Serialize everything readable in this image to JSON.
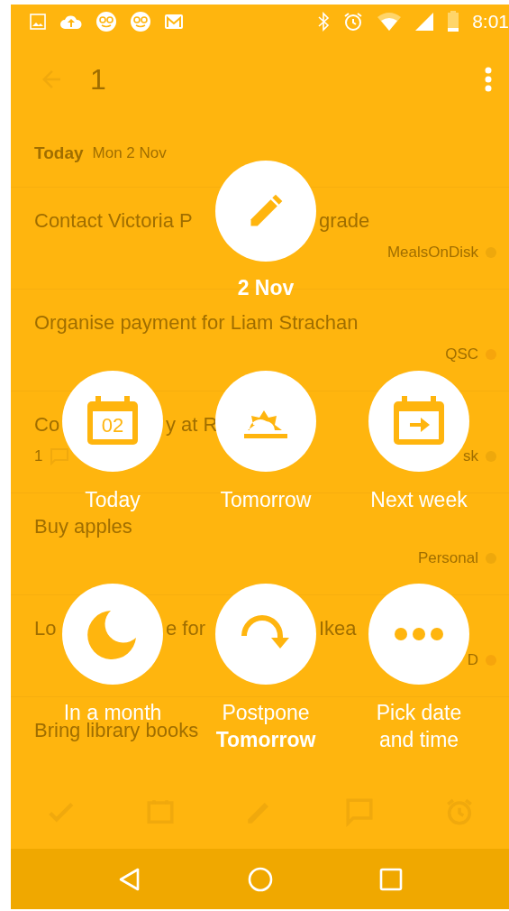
{
  "status_bar": {
    "time": "8:01"
  },
  "app_bar": {
    "title": "1"
  },
  "section": {
    "label": "Today",
    "date": "Mon 2 Nov"
  },
  "tasks": [
    {
      "title_parts": [
        "Contact Victoria P",
        "grade"
      ],
      "tag": "MealsOnDisk",
      "color": "#eea80c"
    },
    {
      "title_parts": [
        "Organise payment for Liam Strachan"
      ],
      "tag": "QSC",
      "color": "#f6a50c"
    },
    {
      "title_parts": [
        "Co",
        "y at R"
      ],
      "comments": "1",
      "tag": "sk",
      "color": "#eea80c"
    },
    {
      "title_parts": [
        "Buy apples"
      ],
      "tag": "Personal",
      "color": "#eea80c"
    },
    {
      "title_parts": [
        "Lo",
        "e for",
        "Ikea"
      ],
      "tag": "D",
      "color": "#f6a50c"
    },
    {
      "title_parts": [
        "Bring library books"
      ]
    }
  ],
  "schedule": {
    "current": "2 Nov",
    "options": [
      {
        "kind": "today",
        "badge": "02",
        "lines": [
          {
            "text": "Today",
            "bold": false
          }
        ]
      },
      {
        "kind": "tomorrow",
        "lines": [
          {
            "text": "Tomorrow",
            "bold": false
          }
        ]
      },
      {
        "kind": "nextweek",
        "lines": [
          {
            "text": "Next week",
            "bold": false
          }
        ]
      },
      {
        "kind": "month",
        "lines": [
          {
            "text": "In a month",
            "bold": false
          }
        ]
      },
      {
        "kind": "postpone",
        "lines": [
          {
            "text": "Postpone",
            "bold": false
          },
          {
            "text": "Tomorrow",
            "bold": true
          }
        ]
      },
      {
        "kind": "custom",
        "lines": [
          {
            "text": "Pick date",
            "bold": false
          },
          {
            "text": "and time",
            "bold": false
          }
        ]
      }
    ]
  }
}
